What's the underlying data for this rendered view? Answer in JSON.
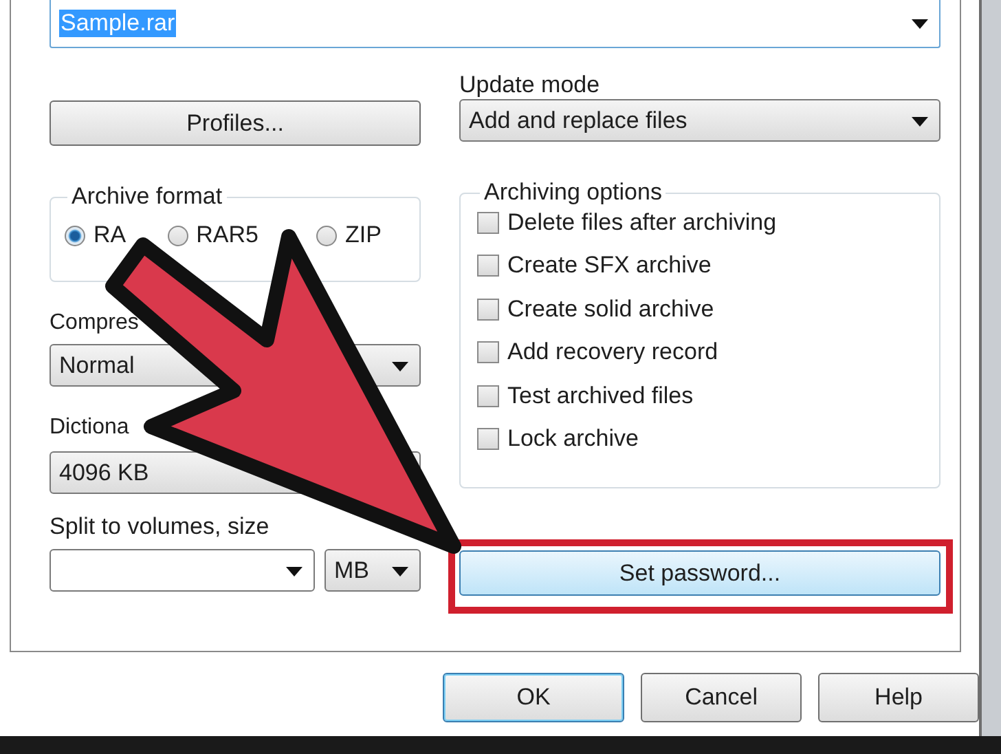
{
  "archive_name": {
    "value": "Sample.rar",
    "text_selected": true
  },
  "profiles_button": {
    "label": "Profiles..."
  },
  "update_mode": {
    "label": "Update mode",
    "value": "Add and replace files"
  },
  "archive_format": {
    "title": "Archive format",
    "options": [
      {
        "label": "RA",
        "selected": true
      },
      {
        "label": "RAR5",
        "selected": false
      },
      {
        "label": "ZIP",
        "selected": false
      }
    ]
  },
  "compression_method": {
    "label": "Compres",
    "value": "Normal"
  },
  "dictionary_size": {
    "label": "Dictiona",
    "value": "4096 KB"
  },
  "split_volumes": {
    "label": "Split to volumes, size",
    "unit": "MB"
  },
  "archiving_options": {
    "title": "Archiving options",
    "items": [
      {
        "label": "Delete files after archiving",
        "checked": false
      },
      {
        "label": "Create SFX archive",
        "checked": false
      },
      {
        "label": "Create solid archive",
        "checked": false
      },
      {
        "label": "Add recovery record",
        "checked": false
      },
      {
        "label": "Test archived files",
        "checked": false
      },
      {
        "label": "Lock archive",
        "checked": false
      }
    ]
  },
  "set_password_button": {
    "label": "Set password...",
    "hovered": true
  },
  "dialog_buttons": [
    {
      "label": "OK",
      "default": true
    },
    {
      "label": "Cancel",
      "default": false
    },
    {
      "label": "Help",
      "default": false
    }
  ]
}
